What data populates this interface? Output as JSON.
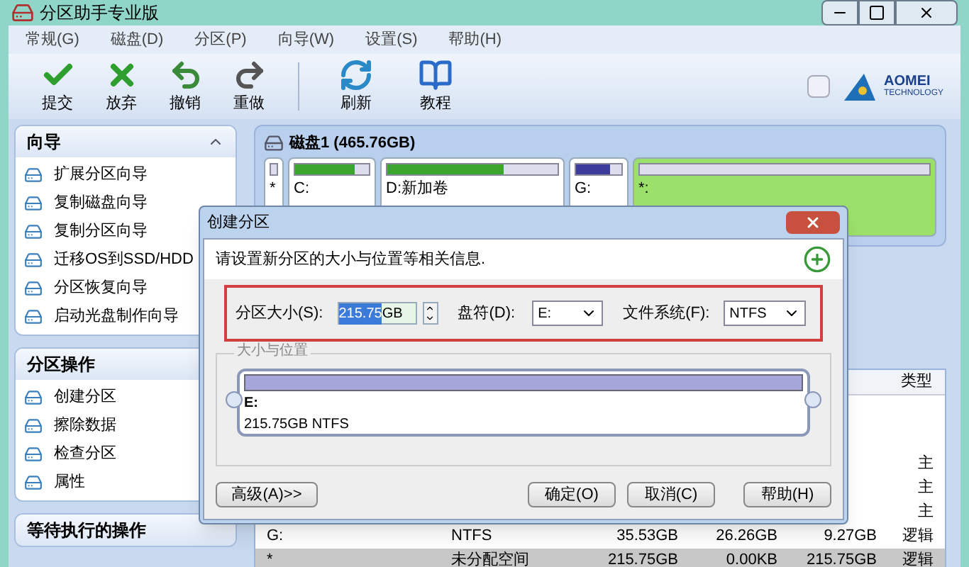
{
  "window": {
    "title": "分区助手专业版"
  },
  "menu": [
    "常规(G)",
    "磁盘(D)",
    "分区(P)",
    "向导(W)",
    "设置(S)",
    "帮助(H)"
  ],
  "toolbar": [
    {
      "kind": "commit",
      "label": "提交"
    },
    {
      "kind": "discard",
      "label": "放弃"
    },
    {
      "kind": "undo",
      "label": "撤销"
    },
    {
      "kind": "redo",
      "label": "重做"
    },
    {
      "kind": "refresh",
      "label": "刷新"
    },
    {
      "kind": "tutorial",
      "label": "教程"
    }
  ],
  "logo": {
    "name": "AOMEI",
    "tagline": "TECHNOLOGY"
  },
  "sidebar": [
    {
      "title": "向导",
      "expanded": true,
      "items": [
        "扩展分区向导",
        "复制磁盘向导",
        "复制分区向导",
        "迁移OS到SSD/HDD",
        "分区恢复向导",
        "启动光盘制作向导"
      ]
    },
    {
      "title": "分区操作",
      "items": [
        "创建分区",
        "擦除数据",
        "检查分区",
        "属性"
      ]
    },
    {
      "title": "等待执行的操作"
    }
  ],
  "disk": {
    "title": "磁盘1 (465.76GB)",
    "partitions": [
      {
        "label": "*"
      },
      {
        "label": "C:",
        "level": 0.8,
        "color": "#3aa62e"
      },
      {
        "label": "D:新加卷",
        "level": 0.68,
        "color": "#3aa62e"
      },
      {
        "label": "G:",
        "level": 0.75,
        "color": "#3c3c9c"
      },
      {
        "label": "*:"
      }
    ]
  },
  "table": {
    "columns": [
      "类型"
    ],
    "rows": [
      {
        "selected": false,
        "cells": [
          "主"
        ]
      },
      {
        "selected": false,
        "cells": [
          "主"
        ]
      },
      {
        "selected": false,
        "cells": [
          "主"
        ]
      },
      {
        "selected": false,
        "cells": [
          "G:",
          "NTFS",
          "35.53GB",
          "26.26GB",
          "9.27GB",
          "逻辑"
        ]
      },
      {
        "selected": true,
        "cells": [
          "*",
          "未分配空间",
          "215.75GB",
          "0.00KB",
          "215.75GB",
          "逻辑"
        ]
      }
    ]
  },
  "dialog": {
    "title": "创建分区",
    "instruction": "请设置新分区的大小与位置等相关信息.",
    "size_label": "分区大小(S):",
    "size_value": "215.75",
    "size_unit": "GB",
    "letter_label": "盘符(D):",
    "letter_value": "E:",
    "fs_label": "文件系统(F):",
    "fs_value": "NTFS",
    "group_label": "大小与位置",
    "partition": {
      "name": "E:",
      "detail": "215.75GB NTFS",
      "level": 1
    },
    "buttons": [
      {
        "kind": "left",
        "label": "高级(A)>>"
      },
      {
        "kind": "right",
        "label": "确定(O)"
      },
      {
        "kind": "right",
        "label": "取消(C)"
      },
      {
        "kind": "help",
        "label": "帮助(H)"
      }
    ]
  }
}
